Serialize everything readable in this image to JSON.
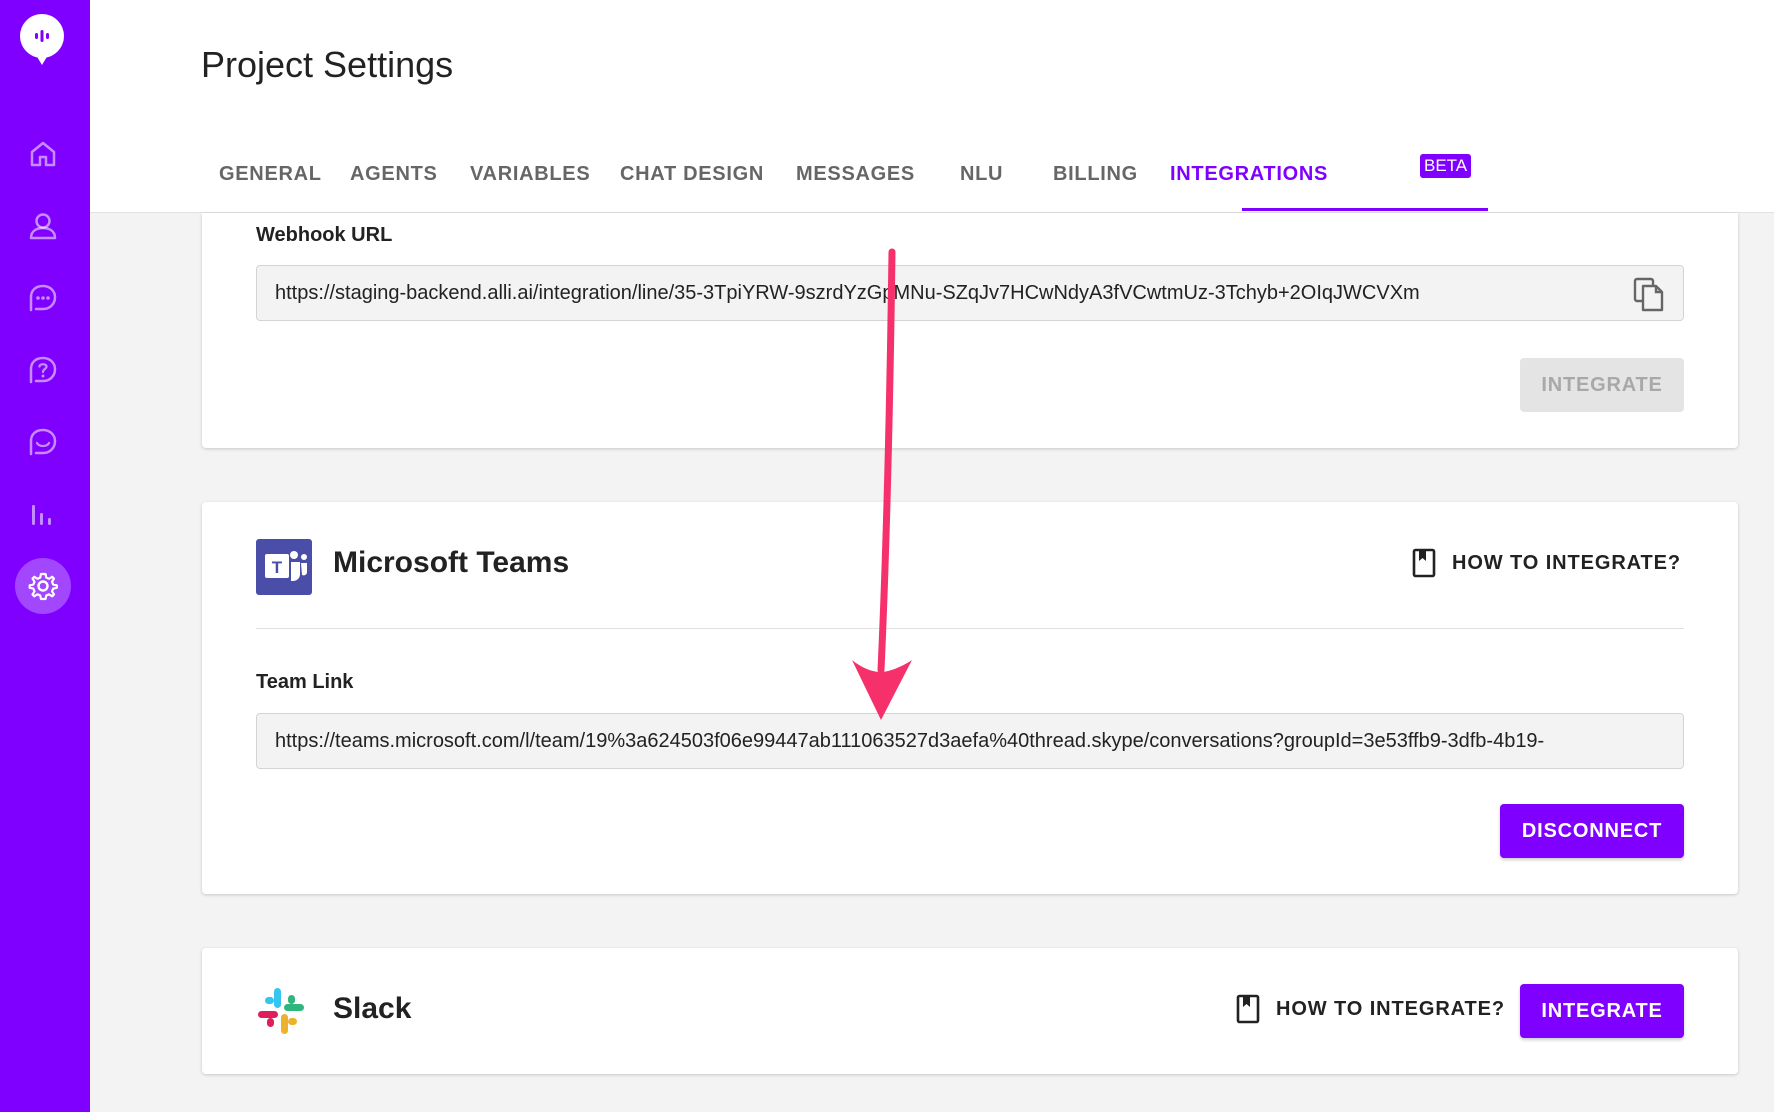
{
  "header": {
    "title": "Project Settings",
    "tabs": [
      {
        "label": "GENERAL",
        "active": false
      },
      {
        "label": "AGENTS",
        "active": false
      },
      {
        "label": "VARIABLES",
        "active": false
      },
      {
        "label": "CHAT DESIGN",
        "active": false
      },
      {
        "label": "MESSAGES",
        "active": false
      },
      {
        "label": "NLU",
        "active": false
      },
      {
        "label": "BILLING",
        "active": false
      },
      {
        "label": "INTEGRATIONS",
        "active": true
      }
    ],
    "beta_badge": "BETA"
  },
  "sidebar": {
    "items": [
      "home-icon",
      "user-icon",
      "chat-icon",
      "help-icon",
      "conversation-icon",
      "analytics-icon",
      "settings-icon"
    ],
    "active": "settings-icon",
    "accent": "#8000ff"
  },
  "line_card": {
    "label": "Webhook URL",
    "url": "https://staging-backend.alli.ai/integration/line/35-3TpiYRW-9szrdYzGpMNu-SZqJv7HCwNdyA3fVCwtmUz-3Tchyb+2OIqJWCVXm",
    "button": "INTEGRATE"
  },
  "teams_card": {
    "title": "Microsoft Teams",
    "howto": "HOW TO INTEGRATE?",
    "label": "Team Link",
    "url": "https://teams.microsoft.com/l/team/19%3a624503f06e99447ab111063527d3aefa%40thread.skype/conversations?groupId=3e53ffb9-3dfb-4b19-",
    "button": "DISCONNECT"
  },
  "slack_card": {
    "title": "Slack",
    "howto": "HOW TO INTEGRATE?",
    "button": "INTEGRATE"
  },
  "annotation_color": "#f5306a"
}
